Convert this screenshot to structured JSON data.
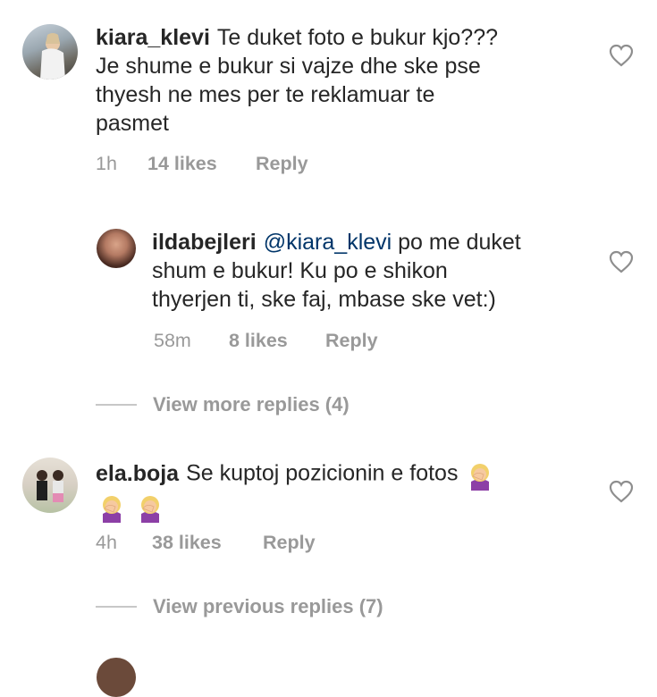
{
  "comments": [
    {
      "username": "kiara_klevi",
      "text": "Te duket foto e bukur kjo??? Je shume e bukur si vajze dhe ske pse thyesh ne mes per te reklamuar te pasmet",
      "line1": "Te duket foto e bukur kjo???",
      "line2": "Je shume e bukur si vajze dhe ske pse",
      "line3": "thyesh ne mes per te reklamuar te",
      "line4": "pasmet",
      "time": "1h",
      "likes": "14 likes",
      "reply": "Reply"
    },
    {
      "username": "ildabejleri",
      "mention": "@kiara_klevi",
      "line1": "po me duket",
      "line2": "shum e bukur! Ku po e shikon",
      "line3": "thyerjen ti, ske faj, mbase ske vet:)",
      "time": "58m",
      "likes": "8 likes",
      "reply": "Reply"
    },
    {
      "username": "ela.boja",
      "line1": "Se kuptoj pozicionin e fotos",
      "emoji_name": "woman-facepalming-emoji",
      "time": "4h",
      "likes": "38 likes",
      "reply": "Reply"
    }
  ],
  "view_more_replies": "View more replies (4)",
  "view_previous_replies": "View previous replies (7)",
  "colors": {
    "text": "#262626",
    "meta": "#999999",
    "mention": "#003569",
    "line": "#c7c7c7"
  }
}
